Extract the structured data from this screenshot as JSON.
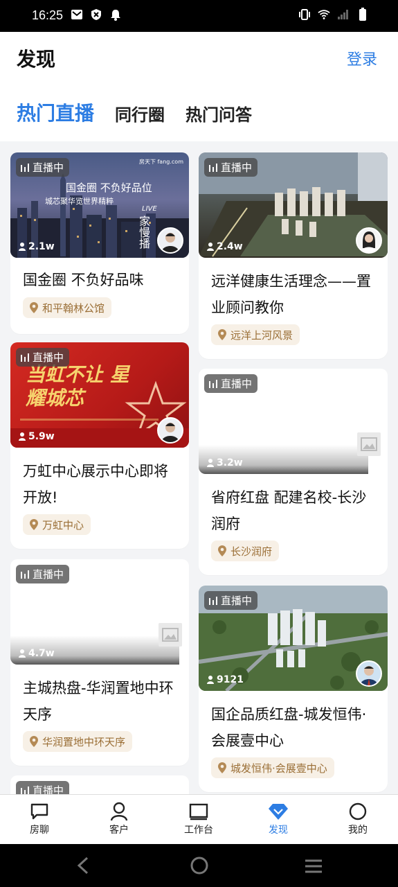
{
  "status_bar": {
    "time": "16:25"
  },
  "header": {
    "title": "发现",
    "login": "登录"
  },
  "tabs": [
    {
      "label": "热门直播",
      "active": true
    },
    {
      "label": "同行圈",
      "active": false
    },
    {
      "label": "热门问答",
      "active": false
    }
  ],
  "live_label": "直播中",
  "cards": [
    {
      "viewers": "2.1w",
      "title": "国金圈 不负好品味",
      "title2": "",
      "location": "和平翰林公馆",
      "banner_main": "国金圈 不负好品位",
      "banner_sub": "城芯聚华览世界精粹",
      "banner_live": "LIVE",
      "banner_chars": "家 慢 播",
      "banner_logo": "房天下 fang.com"
    },
    {
      "viewers": "2.4w",
      "title": "远洋健康生活理念——置",
      "title2": "业顾问教你",
      "location": "远洋上河风景"
    },
    {
      "viewers": "5.9w",
      "title": "万虹中心展示中心即将",
      "title2": "开放!",
      "location": "万虹中心",
      "banner_main": "当虹不让 星耀城芯"
    },
    {
      "viewers": "3.2w",
      "title": "省府红盘 配建名校-长沙",
      "title2": "润府",
      "location": "长沙润府"
    },
    {
      "viewers": "4.7w",
      "title": "主城热盘-华润置地中环",
      "title2": "天序",
      "location": "华润置地中环天序"
    },
    {
      "viewers": "9121",
      "title": "国企品质红盘-城发恒伟·",
      "title2": "会展壹中心",
      "location": "城发恒伟·会展壹中心"
    }
  ],
  "nav": [
    {
      "label": "房聊",
      "icon": "chat-icon",
      "active": false
    },
    {
      "label": "客户",
      "icon": "person-icon",
      "active": false
    },
    {
      "label": "工作台",
      "icon": "workbench-icon",
      "active": false
    },
    {
      "label": "发现",
      "icon": "diamond-icon",
      "active": true
    },
    {
      "label": "我的",
      "icon": "circle-icon",
      "active": false
    }
  ]
}
